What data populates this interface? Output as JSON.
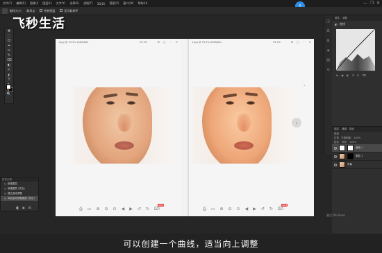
{
  "menubar": {
    "items": [
      "文件(F)",
      "编辑(E)",
      "图像(I)",
      "图层(L)",
      "文字(Y)",
      "选择(S)",
      "滤镜(T)",
      "3D(D)",
      "视图(V)",
      "窗口(W)",
      "帮助(H)"
    ]
  },
  "optbar": {
    "sample_label": "取样大小:",
    "sample_value": "取样点",
    "all_layers": "所有图层",
    "show_ring": "显示取样环"
  },
  "window_controls": {
    "minimize": "—",
    "restore": "❐",
    "close": "✕"
  },
  "watermark": {
    "text": "飞秒生活"
  },
  "tools": [
    "✥",
    "⬚",
    "ʘ",
    "⌖",
    "✂",
    "✎",
    "⌫",
    "◐",
    "✍",
    "◭",
    "T",
    "↖",
    "✋",
    "🔍"
  ],
  "history": {
    "title": "历史记录",
    "rows": [
      "新建图层",
      "新建图层 (拼合)",
      "建立曲线调整",
      "添加曲线调整图层 (拼合)"
    ],
    "footer_icons": [
      "camera",
      "new",
      "trash"
    ]
  },
  "canvas": {
    "left_title": "1.jpg @ 33.3% (RGB/8#)",
    "right_title": "1.jpg @ 33.3% (RGB/8#)",
    "zoom": "33.3%",
    "top_icons": [
      "⊞",
      "▢",
      "⋯",
      "✕"
    ],
    "bottom_icons": [
      "⎙",
      "▭",
      "⊕",
      "⊖",
      "⊙",
      "◀",
      "▶",
      "↺",
      "↻",
      "⌦"
    ],
    "badge": "NEW",
    "nav": "›"
  },
  "right_panel": {
    "tabs": [
      "属性",
      "调整"
    ],
    "properties_title": "曲线",
    "curve_icons": [
      "⇆",
      "◉",
      "◐",
      "↺",
      "⊘",
      "⌫"
    ],
    "layers_tabs": [
      "图层",
      "通道",
      "路径"
    ],
    "kind_label": "类型",
    "mode": "正常",
    "opacity_label": "不透明度:",
    "opacity": "100%",
    "lock_label": "锁定:",
    "fill_label": "填充:",
    "fill": "100%",
    "layers": [
      {
        "name": "曲线 1",
        "type": "adjust",
        "selected": true
      },
      {
        "name": "图层 1",
        "type": "mask",
        "selected": false
      },
      {
        "name": "背景",
        "type": "img",
        "selected": false
      }
    ]
  },
  "strip_icons": [
    "◫",
    "☰",
    "⚙",
    "◈",
    "▤",
    "⟲"
  ],
  "subtitle": "可以创建一个曲线，适当向上调整",
  "os_watermark": "激活 Windows"
}
